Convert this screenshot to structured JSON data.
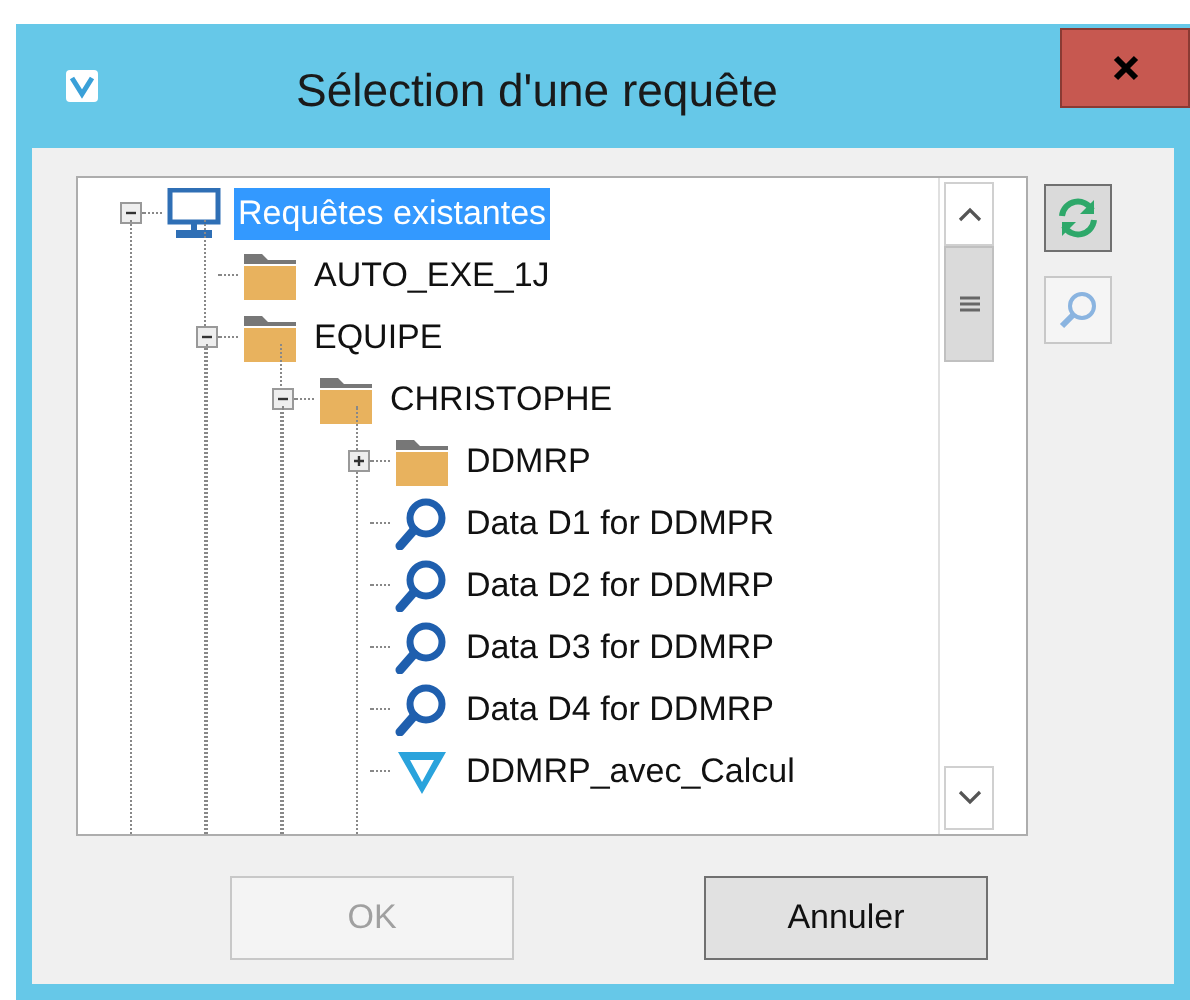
{
  "window": {
    "title": "Sélection d'une requête"
  },
  "tree": [
    {
      "label": "Requêtes existantes",
      "kind": "computer",
      "selected": true,
      "expanded": true,
      "children": [
        {
          "label": "AUTO_EXE_1J",
          "kind": "folder",
          "selected": false
        },
        {
          "label": "EQUIPE",
          "kind": "folder",
          "selected": false,
          "expanded": true,
          "children": [
            {
              "label": "CHRISTOPHE",
              "kind": "folder",
              "selected": false,
              "expanded": true,
              "children": [
                {
                  "label": "DDMRP",
                  "kind": "folder",
                  "selected": false,
                  "expanded": false
                },
                {
                  "label": "Data D1 for DDMPR",
                  "kind": "query",
                  "selected": false
                },
                {
                  "label": "Data D2 for DDMRP",
                  "kind": "query",
                  "selected": false
                },
                {
                  "label": "Data D3 for DDMRP",
                  "kind": "query",
                  "selected": false
                },
                {
                  "label": "Data D4 for DDMRP",
                  "kind": "query",
                  "selected": false
                },
                {
                  "label": "DDMRP_avec_Calcul",
                  "kind": "view",
                  "selected": false
                }
              ]
            }
          ]
        }
      ]
    }
  ],
  "buttons": [
    {
      "label": "OK",
      "disabled": true
    },
    {
      "label": "Annuler",
      "disabled": false
    }
  ]
}
